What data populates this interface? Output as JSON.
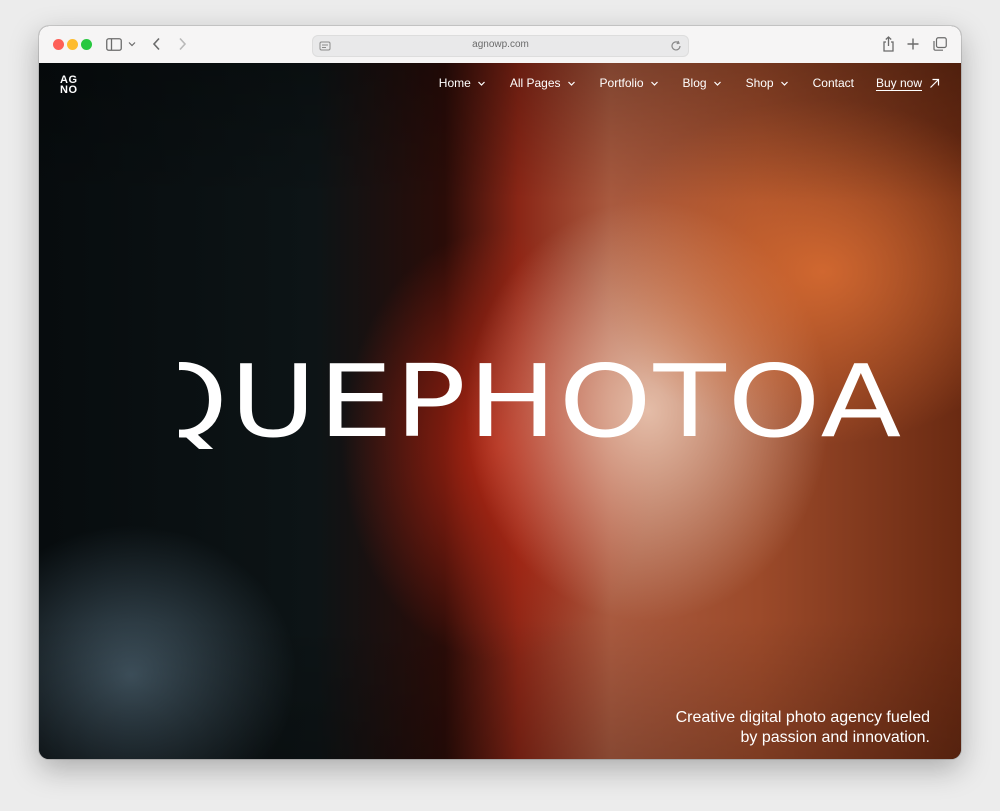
{
  "browser": {
    "url": "agnowp.com",
    "icons": {
      "sidebar": "sidebar-icon",
      "back": "chevron-left-icon",
      "forward": "chevron-right-icon",
      "reload": "reload-icon",
      "share": "share-icon",
      "new_tab": "plus-icon",
      "tabs": "tabs-overview-icon"
    }
  },
  "site": {
    "logo_line1": "AG",
    "logo_line2": "NO",
    "nav": [
      {
        "label": "Home"
      },
      {
        "label": "All Pages"
      },
      {
        "label": "Portfolio"
      },
      {
        "label": "Blog"
      },
      {
        "label": "Shop"
      }
    ],
    "contact_label": "Contact",
    "buy_label": "Buy now",
    "marquee_text": "QUEPHOTOA",
    "tagline_line1": "Creative digital photo agency fueled",
    "tagline_line2": "by passion and innovation."
  },
  "colors": {
    "text_light": "#ffffff",
    "traffic_red": "#fe5f57",
    "traffic_yellow": "#febc2e",
    "traffic_green": "#28c840"
  }
}
